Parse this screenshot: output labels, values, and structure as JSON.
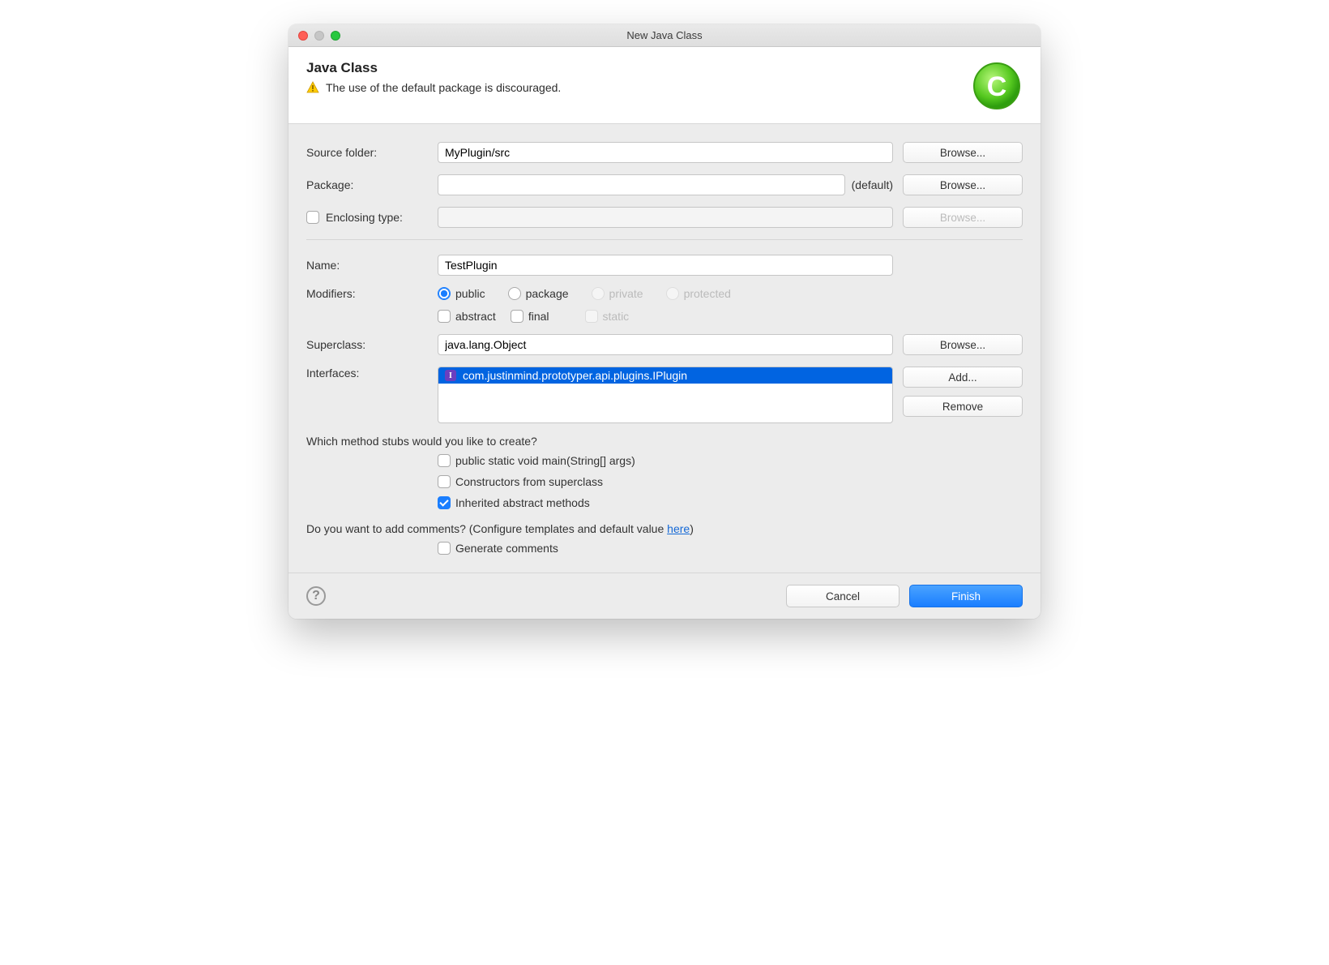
{
  "title": "New Java Class",
  "header": {
    "heading": "Java Class",
    "warning": "The use of the default package is discouraged."
  },
  "fields": {
    "source_folder": {
      "label": "Source folder:",
      "value": "MyPlugin/src",
      "browse": "Browse..."
    },
    "package": {
      "label": "Package:",
      "value": "",
      "default_tag": "(default)",
      "browse": "Browse..."
    },
    "enclosing": {
      "label": "Enclosing type:",
      "value": "",
      "browse": "Browse..."
    },
    "name": {
      "label": "Name:",
      "value": "TestPlugin"
    },
    "modifiers": {
      "label": "Modifiers:",
      "visibility": {
        "public": "public",
        "package": "package",
        "private": "private",
        "protected": "protected"
      },
      "flags": {
        "abstract": "abstract",
        "final": "final",
        "static": "static"
      }
    },
    "superclass": {
      "label": "Superclass:",
      "value": "java.lang.Object",
      "browse": "Browse..."
    },
    "interfaces": {
      "label": "Interfaces:",
      "items": [
        "com.justinmind.prototyper.api.plugins.IPlugin"
      ],
      "add": "Add...",
      "remove": "Remove"
    }
  },
  "stubs": {
    "question": "Which method stubs would you like to create?",
    "main": "public static void main(String[] args)",
    "constructors": "Constructors from superclass",
    "inherited": "Inherited abstract methods"
  },
  "comments": {
    "question_prefix": "Do you want to add comments? (Configure templates and default value ",
    "link": "here",
    "question_suffix": ")",
    "generate": "Generate comments"
  },
  "footer": {
    "cancel": "Cancel",
    "finish": "Finish"
  }
}
